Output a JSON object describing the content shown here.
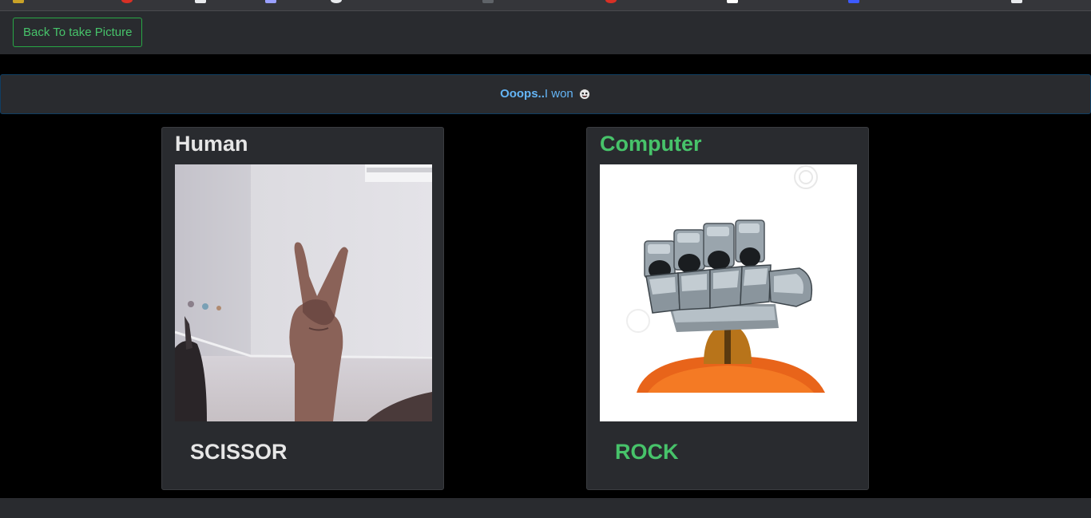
{
  "toolbar": {
    "back_label": "Back To take Picture"
  },
  "alert": {
    "strong": "Ooops..",
    "message": "I won",
    "emoji": "devil-face-icon"
  },
  "human": {
    "title": "Human",
    "choice": "SCISSOR",
    "image": "hand-scissor-photo"
  },
  "computer": {
    "title": "Computer",
    "choice": "ROCK",
    "image": "robot-fist-rock"
  },
  "colors": {
    "accent_green": "#47c36a",
    "alert_blue": "#64b5f6",
    "panel": "#292b2f",
    "background": "#000000"
  }
}
